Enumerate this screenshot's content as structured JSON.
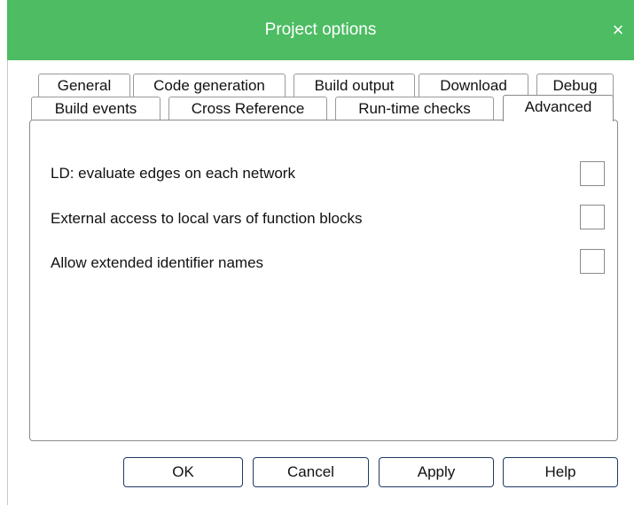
{
  "window": {
    "title": "Project options",
    "close_glyph": "×",
    "title_bar_color": "#4dbc63"
  },
  "tabs_row1": [
    {
      "label": "General"
    },
    {
      "label": "Code generation"
    },
    {
      "label": "Build output"
    },
    {
      "label": "Download"
    },
    {
      "label": "Debug"
    }
  ],
  "tabs_row2": [
    {
      "label": "Build events"
    },
    {
      "label": "Cross Reference"
    },
    {
      "label": "Run-time checks"
    },
    {
      "label": "Advanced",
      "active": true
    }
  ],
  "options": [
    {
      "label": "LD: evaluate edges on each network",
      "checked": false
    },
    {
      "label": "External access to local vars of function blocks",
      "checked": false
    },
    {
      "label": "Allow extended identifier names",
      "checked": false
    }
  ],
  "buttons": {
    "ok": "OK",
    "cancel": "Cancel",
    "apply": "Apply",
    "help": "Help"
  }
}
